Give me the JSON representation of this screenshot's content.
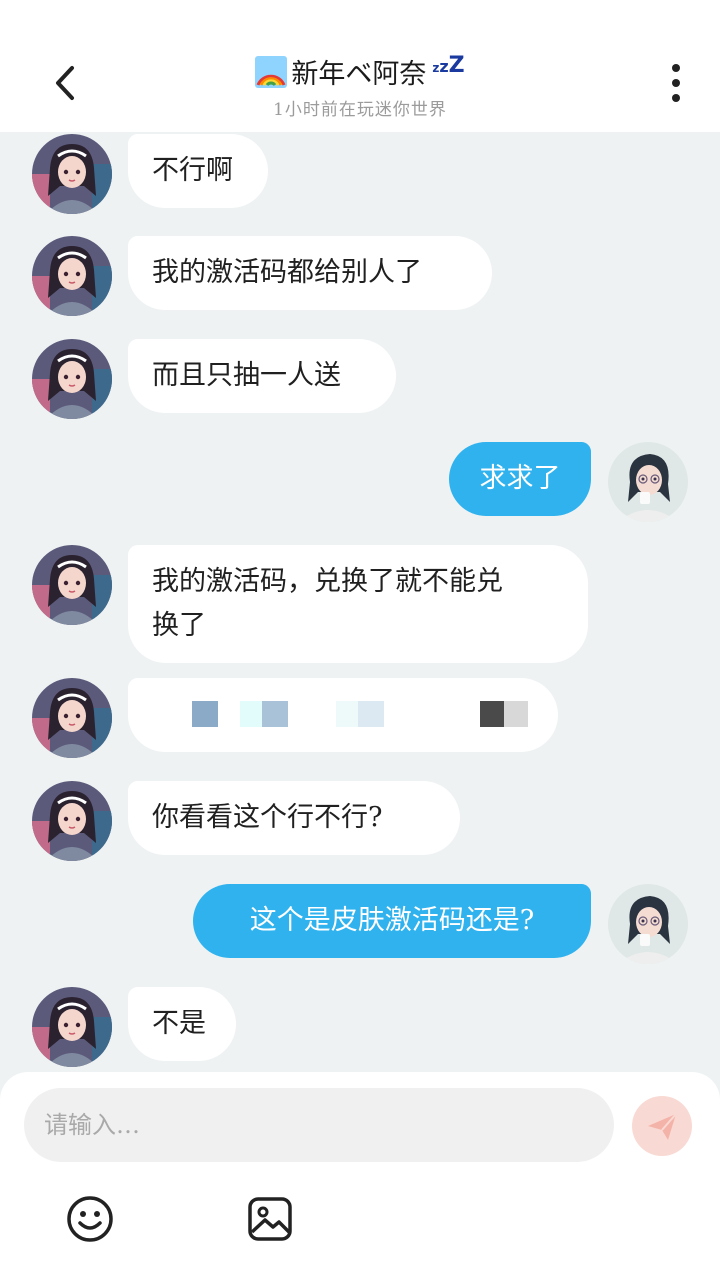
{
  "header": {
    "title": "新年ベ阿奈",
    "zzz": [
      "z",
      "z",
      "Z"
    ],
    "subtitle": "1小时前在玩迷你世界"
  },
  "messages": [
    {
      "side": "left",
      "text": "不行啊"
    },
    {
      "side": "left",
      "text": "我的激活码都给别人了"
    },
    {
      "side": "left",
      "text": "而且只抽一人送"
    },
    {
      "side": "right",
      "text": "求求了"
    },
    {
      "side": "left",
      "line1": "我的激活码，兑换了就不能兑",
      "line2": "换了"
    },
    {
      "side": "left",
      "text": "",
      "kind": "pixelated-code"
    },
    {
      "side": "left",
      "text": "你看看这个行不行?"
    },
    {
      "side": "right",
      "text": "这个是皮肤激活码还是?"
    },
    {
      "side": "left",
      "text": "不是"
    }
  ],
  "composer": {
    "placeholder": "请输入…",
    "icons": [
      "emoji-icon",
      "image-icon",
      "send-icon"
    ]
  },
  "colors": {
    "outgoing_bubble": "#2fb2ee",
    "incoming_bubble": "#ffffff",
    "chat_background": "#eef2f3",
    "send_button": "#f9d9d3"
  }
}
